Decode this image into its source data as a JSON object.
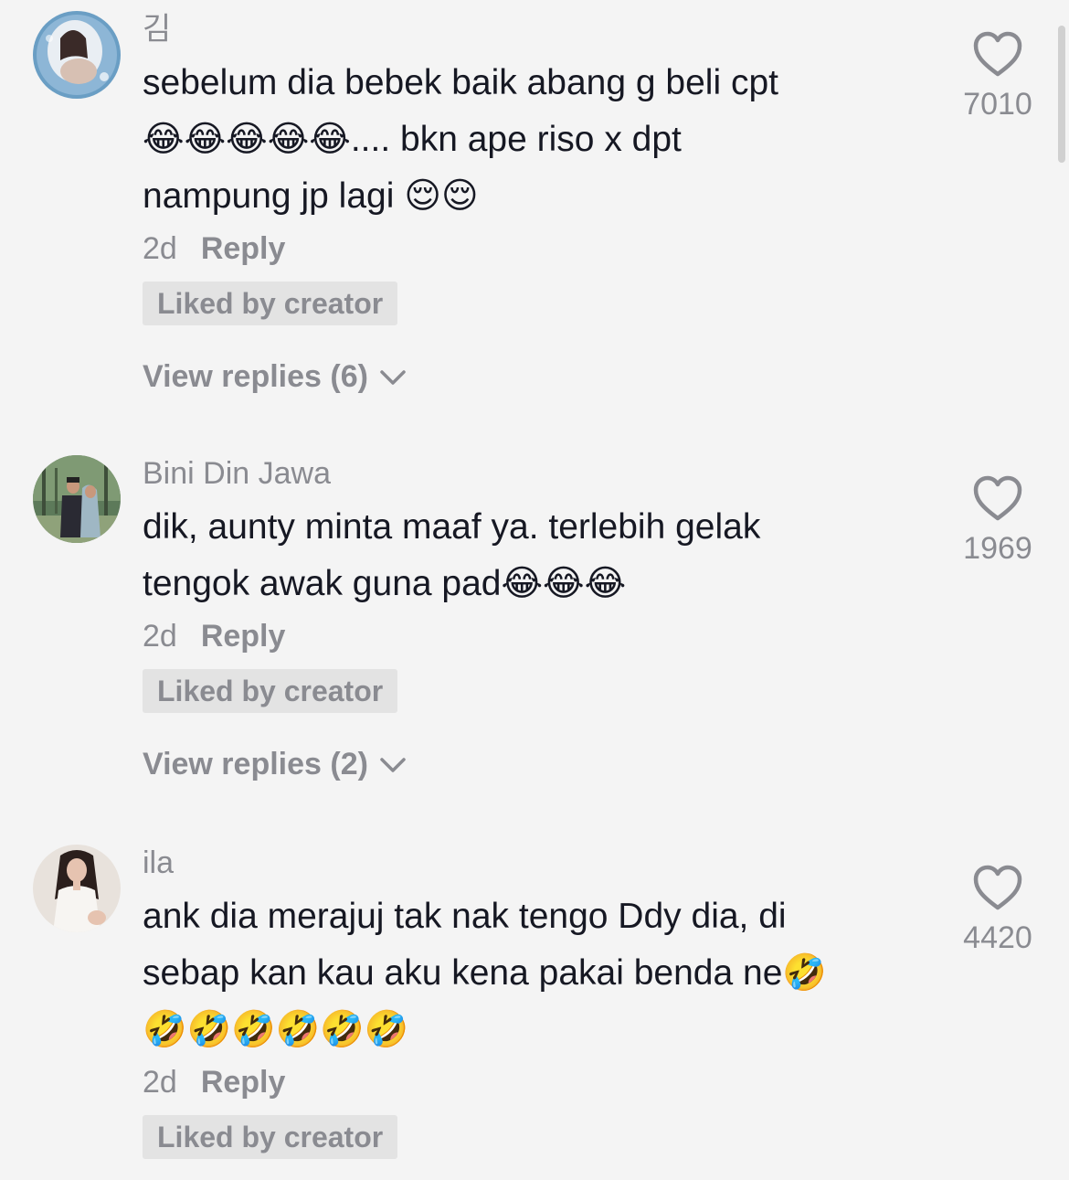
{
  "comments": [
    {
      "username": "김",
      "text": "sebelum dia bebek baik abang g beli cpt\n😂😂😂😂😂.... bkn ape riso x dpt\nnampung jp lagi 😌😌",
      "time": "2d",
      "reply_label": "Reply",
      "liked_label": "Liked by creator",
      "view_replies": "View replies (6)",
      "likes": "7010"
    },
    {
      "username": "Bini Din Jawa",
      "text": "dik, aunty minta maaf ya. terlebih gelak\ntengok awak guna pad😂😂😂",
      "time": "2d",
      "reply_label": "Reply",
      "liked_label": "Liked by creator",
      "view_replies": "View replies (2)",
      "likes": "1969"
    },
    {
      "username": "ila",
      "text": "ank dia merajuj tak nak tengo Ddy dia, di\nsebap kan kau aku kena pakai benda ne🤣\n🤣🤣🤣🤣🤣🤣",
      "time": "2d",
      "reply_label": "Reply",
      "liked_label": "Liked by creator",
      "likes": "4420"
    }
  ],
  "icons": {
    "heart": "heart-outline-icon",
    "chevron": "chevron-down-icon"
  },
  "colors": {
    "background": "#f4f4f4",
    "secondary_text": "#8a8b91",
    "primary_text": "#161823",
    "badge_bg": "#e3e3e3"
  }
}
